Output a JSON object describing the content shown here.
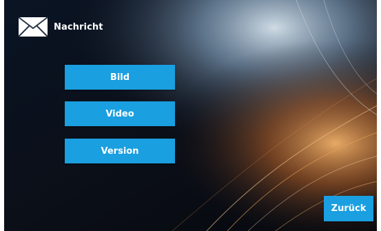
{
  "header": {
    "icon": "mail-icon",
    "title": "Nachricht"
  },
  "menu": {
    "items": [
      {
        "label": "Bild"
      },
      {
        "label": "Video"
      },
      {
        "label": "Version"
      }
    ]
  },
  "footer": {
    "back_label": "Zurück"
  },
  "colors": {
    "button": "#1a9fe0",
    "text": "#ffffff",
    "background_dark": "#0b0f1a",
    "glow_warm": "#e08a3a",
    "glow_cool": "#a8c4dc"
  }
}
